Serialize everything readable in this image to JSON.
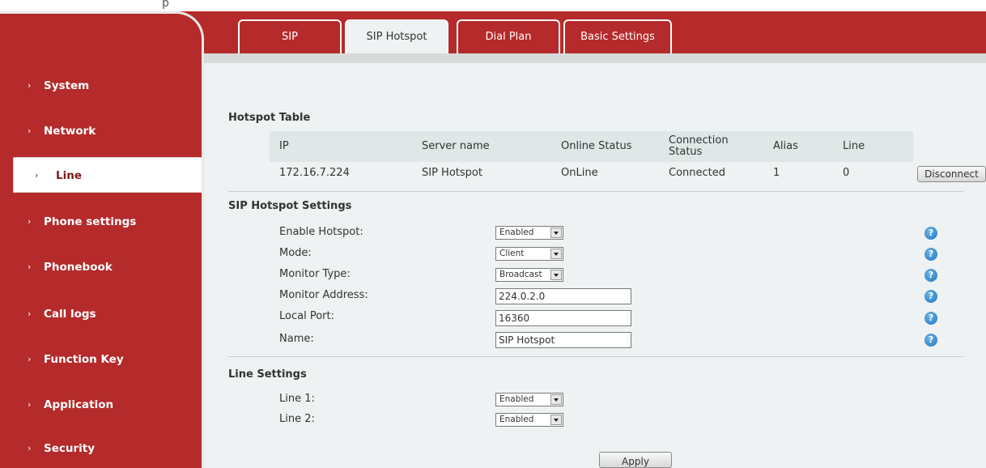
{
  "header": {
    "top_fragment": "p"
  },
  "tabs": [
    {
      "label": "SIP"
    },
    {
      "label": "SIP Hotspot"
    },
    {
      "label": "Dial Plan"
    },
    {
      "label": "Basic Settings"
    }
  ],
  "sidebar": {
    "items": [
      {
        "label": "System"
      },
      {
        "label": "Network"
      },
      {
        "label": "Line"
      },
      {
        "label": "Phone settings"
      },
      {
        "label": "Phonebook"
      },
      {
        "label": "Call logs"
      },
      {
        "label": "Function Key"
      },
      {
        "label": "Application"
      },
      {
        "label": "Security"
      }
    ],
    "chevron": "›"
  },
  "hotspot_table": {
    "title": "Hotspot Table",
    "headers": [
      "IP",
      "Server name",
      "Online Status",
      "Connection Status",
      "Alias",
      "Line"
    ],
    "rows": [
      {
        "ip": "172.16.7.224",
        "server_name": "SIP Hotspot",
        "online_status": "OnLine",
        "connection_status": "Connected",
        "alias": "1",
        "line": "0",
        "action": "Disconnect"
      }
    ]
  },
  "hotspot_settings": {
    "title": "SIP Hotspot Settings",
    "enable_hotspot": {
      "label": "Enable Hotspot:",
      "value": "Enabled"
    },
    "mode": {
      "label": "Mode:",
      "value": "Client"
    },
    "monitor_type": {
      "label": "Monitor Type:",
      "value": "Broadcast"
    },
    "monitor_address": {
      "label": "Monitor Address:",
      "value": "224.0.2.0"
    },
    "local_port": {
      "label": "Local Port:",
      "value": "16360"
    },
    "name": {
      "label": "Name:",
      "value": "SIP Hotspot"
    },
    "help_glyph": "?"
  },
  "line_settings": {
    "title": "Line Settings",
    "line1": {
      "label": "Line 1:",
      "value": "Enabled"
    },
    "line2": {
      "label": "Line 2:",
      "value": "Enabled"
    }
  },
  "apply_label": "Apply",
  "colors": {
    "brand_red": "#b52a2a",
    "content_bg": "#eef2f2",
    "table_head_bg": "#dfe7e7",
    "help_blue": "#1e73bd"
  }
}
